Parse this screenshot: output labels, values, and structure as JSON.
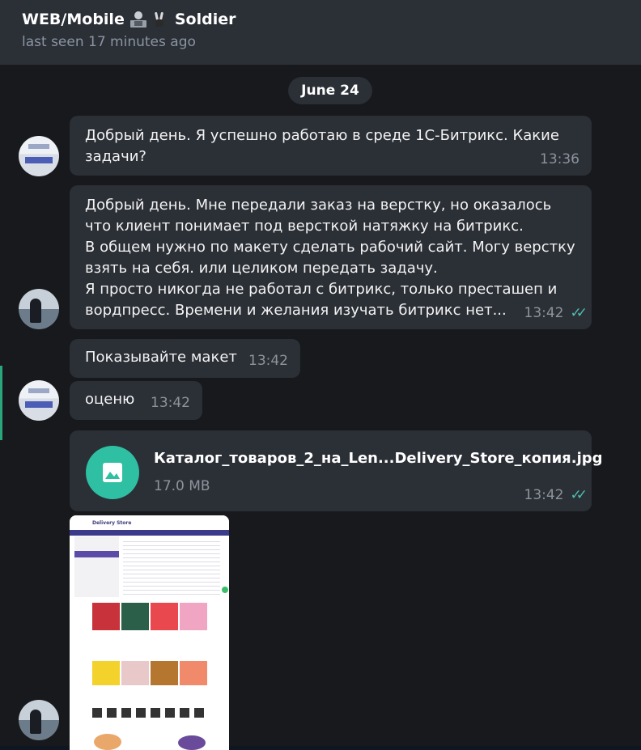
{
  "header": {
    "title_left": "WEB/Mobile",
    "title_right": "Soldier",
    "status": "last seen 17 minutes ago"
  },
  "date_label": "June 24",
  "messages": [
    {
      "text": "Добрый день. Я успешно работаю в среде 1С-Битрикс. Какие задачи?",
      "time": "13:36"
    },
    {
      "text": "Добрый день. Мне передали заказ на верстку, но оказалось что клиент понимает под версткой натяжку на битрикс.\nВ общем нужно по макету сделать рабочий сайт. Могу верстку взять на себя. или целиком передать задачу.\nЯ просто никогда не работал с битрикс, только престашеп и вордпресс. Времени и желания изучать битрикс нет...",
      "time": "13:42"
    },
    {
      "text": "Показывайте макет",
      "time": "13:42"
    },
    {
      "text": "оценю",
      "time": "13:42"
    }
  ],
  "file": {
    "name": "Каталог_товаров_2_на_Len...Delivery_Store_копия.jpg",
    "size": "17.0 MB",
    "time": "13:42",
    "icon": "image-icon"
  },
  "thumbnail": {
    "brand": "Delivery Store"
  },
  "colors": {
    "accent": "#2fbfa3",
    "bubble": "#2b2f36",
    "background": "#17191c"
  }
}
